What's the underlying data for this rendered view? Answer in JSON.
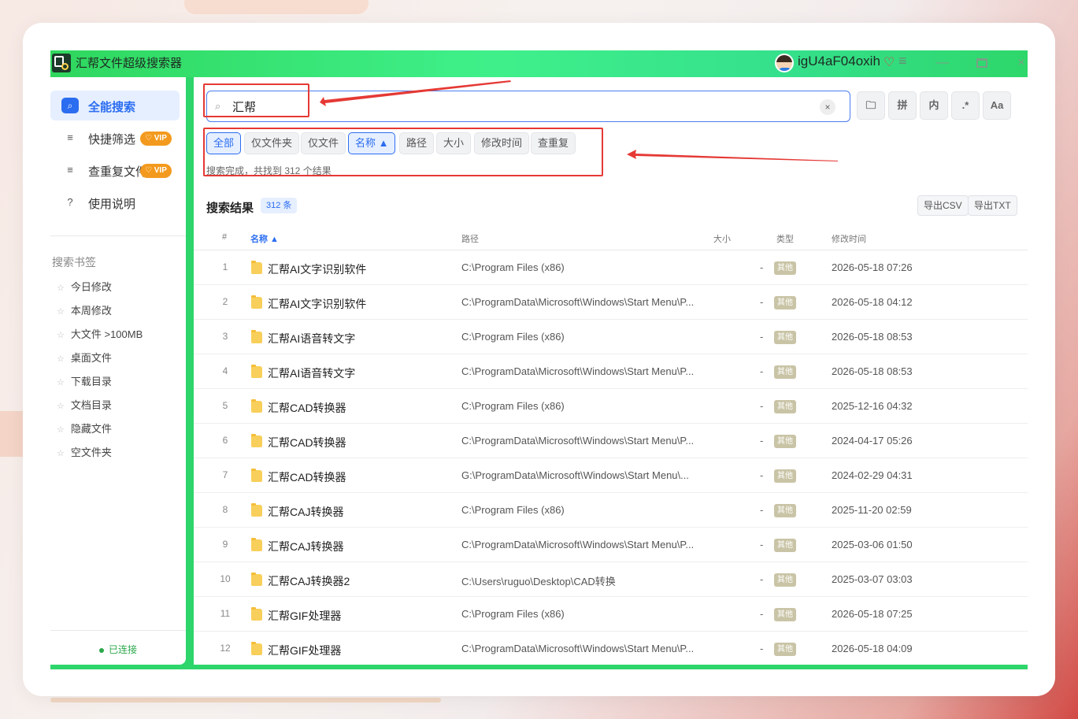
{
  "app": {
    "title": "汇帮文件超级搜索器",
    "username": "igU4aF04oxih",
    "vip_icon": "diamond-heart-icon",
    "menu_icon": "≡",
    "minimize": "—",
    "close": "×"
  },
  "sidebar": {
    "items": [
      {
        "label": "全能搜索",
        "icon": "⌕",
        "active": true
      },
      {
        "label": "快捷筛选",
        "icon": "≡",
        "badge": "♡ VIP"
      },
      {
        "label": "查重复文件",
        "icon": "≡",
        "badge": "♡ VIP"
      },
      {
        "label": "使用说明",
        "icon": "?"
      }
    ],
    "bookmarks_title": "搜索书签",
    "bookmarks": [
      "今日修改",
      "本周修改",
      "大文件 >100MB",
      "桌面文件",
      "下载目录",
      "文档目录",
      "隐藏文件",
      "空文件夹"
    ],
    "bookmark_star": "☆",
    "status": "已连接"
  },
  "search": {
    "value": "汇帮",
    "icon": "⌕",
    "clear": "×",
    "tools": [
      "🗀",
      "拼",
      "内",
      ".*",
      "Aa"
    ]
  },
  "filters": [
    "全部",
    "仅文件夹",
    "仅文件",
    "名称 ▲",
    "路径",
    "大小",
    "修改时间",
    "查重复"
  ],
  "status_text": "搜索完成，共找到 312 个结果",
  "results": {
    "title": "搜索结果",
    "count": "312 条",
    "export_csv": "导出CSV",
    "export_txt": "导出TXT",
    "headers": {
      "num": "#",
      "name": "名称 ▲",
      "path": "路径",
      "size": "大小",
      "type": "类型",
      "mtime": "修改时间"
    },
    "rows": [
      {
        "num": "1",
        "name": "汇帮AI文字识别软件",
        "path": "C:\\Program Files (x86)",
        "size": "-",
        "type": "其他",
        "mtime": "2026-05-18 07:26"
      },
      {
        "num": "2",
        "name": "汇帮AI文字识别软件",
        "path": "C:\\ProgramData\\Microsoft\\Windows\\Start Menu\\P...",
        "size": "-",
        "type": "其他",
        "mtime": "2026-05-18 04:12"
      },
      {
        "num": "3",
        "name": "汇帮AI语音转文字",
        "path": "C:\\Program Files (x86)",
        "size": "-",
        "type": "其他",
        "mtime": "2026-05-18 08:53"
      },
      {
        "num": "4",
        "name": "汇帮AI语音转文字",
        "path": "C:\\ProgramData\\Microsoft\\Windows\\Start Menu\\P...",
        "size": "-",
        "type": "其他",
        "mtime": "2026-05-18 08:53"
      },
      {
        "num": "5",
        "name": "汇帮CAD转换器",
        "path": "C:\\Program Files (x86)",
        "size": "-",
        "type": "其他",
        "mtime": "2025-12-16 04:32"
      },
      {
        "num": "6",
        "name": "汇帮CAD转换器",
        "path": "C:\\ProgramData\\Microsoft\\Windows\\Start Menu\\P...",
        "size": "-",
        "type": "其他",
        "mtime": "2024-04-17 05:26"
      },
      {
        "num": "7",
        "name": "汇帮CAD转换器",
        "path": "G:\\ProgramData\\Microsoft\\Windows\\Start Menu\\...",
        "size": "-",
        "type": "其他",
        "mtime": "2024-02-29 04:31"
      },
      {
        "num": "8",
        "name": "汇帮CAJ转换器",
        "path": "C:\\Program Files (x86)",
        "size": "-",
        "type": "其他",
        "mtime": "2025-11-20 02:59"
      },
      {
        "num": "9",
        "name": "汇帮CAJ转换器",
        "path": "C:\\ProgramData\\Microsoft\\Windows\\Start Menu\\P...",
        "size": "-",
        "type": "其他",
        "mtime": "2025-03-06 01:50"
      },
      {
        "num": "10",
        "name": "汇帮CAJ转换器2",
        "path": "C:\\Users\\ruguo\\Desktop\\CAD转换",
        "size": "-",
        "type": "其他",
        "mtime": "2025-03-07 03:03"
      },
      {
        "num": "11",
        "name": "汇帮GIF处理器",
        "path": "C:\\Program Files (x86)",
        "size": "-",
        "type": "其他",
        "mtime": "2026-05-18 07:25"
      },
      {
        "num": "12",
        "name": "汇帮GIF处理器",
        "path": "C:\\ProgramData\\Microsoft\\Windows\\Start Menu\\P...",
        "size": "-",
        "type": "其他",
        "mtime": "2026-05-18 04:09"
      }
    ]
  },
  "colors": {
    "accent": "#2b6df0",
    "titlebar": "#3ff08a",
    "annotation": "#e53935",
    "vip": "#f39a1e"
  }
}
